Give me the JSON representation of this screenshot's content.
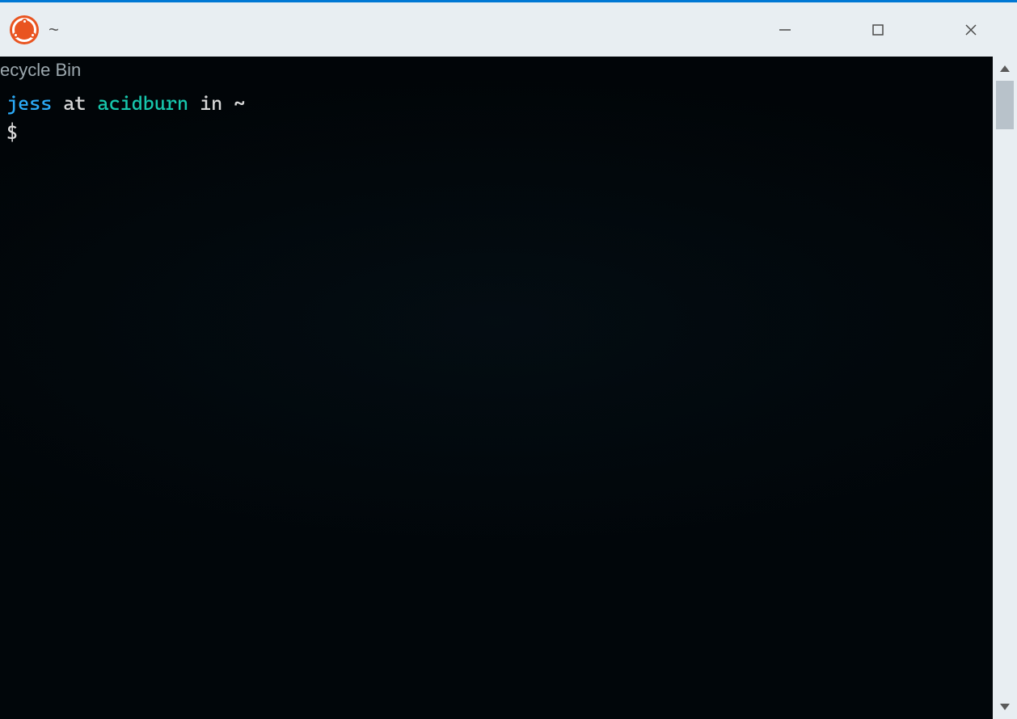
{
  "window": {
    "title": "~",
    "app_icon": "ubuntu-icon"
  },
  "desktop": {
    "bleed_label": "ecycle Bin"
  },
  "terminal": {
    "prompt": {
      "user": "jess",
      "sep_at": " at ",
      "host": "acidburn",
      "sep_in": " in ",
      "path": "~",
      "symbol": "$"
    }
  },
  "colors": {
    "titlebar_bg": "#e8eef2",
    "titlebar_accent": "#0078d4",
    "terminal_bg": "#01060a",
    "prompt_user": "#2baaf7",
    "prompt_host": "#17c7ad",
    "prompt_text": "#d8d8d8",
    "ubuntu_orange": "#e95420"
  }
}
